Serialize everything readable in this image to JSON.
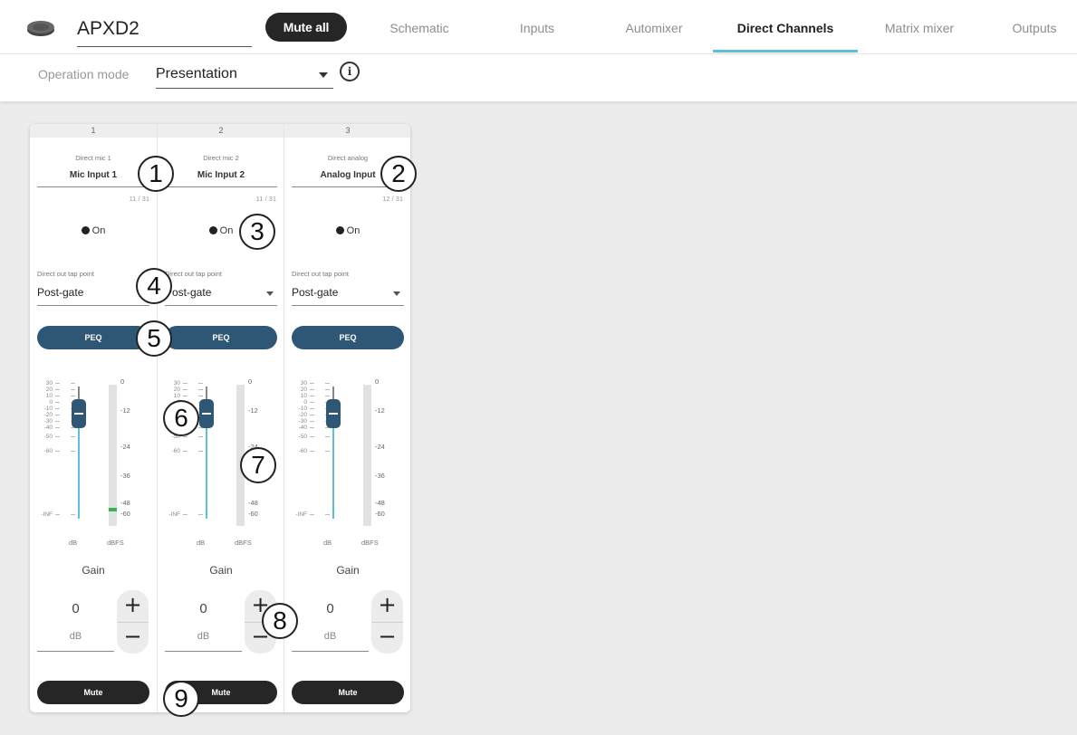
{
  "device": {
    "name": "APXD2",
    "mute_all": "Mute all"
  },
  "tabs": [
    {
      "label": "Schematic",
      "active": false
    },
    {
      "label": "Inputs",
      "active": false
    },
    {
      "label": "Automixer",
      "active": false
    },
    {
      "label": "Direct Channels",
      "active": true
    },
    {
      "label": "Matrix mixer",
      "active": false
    },
    {
      "label": "Outputs",
      "active": false
    }
  ],
  "operation_mode": {
    "label": "Operation mode",
    "value": "Presentation",
    "info_icon": "info-icon"
  },
  "accent_colors": {
    "peq": "#2e5776",
    "active_tab": "#5bc0de",
    "meter": "#3eb24a",
    "mute": "#262626"
  },
  "fader_scale": [
    "30",
    "20",
    "10",
    "0",
    "-10",
    "-20",
    "-30",
    "-40",
    "-50",
    "-60",
    "-INF"
  ],
  "meter_scale": [
    "0",
    "-12",
    "-24",
    "-36",
    "-48",
    "-60"
  ],
  "units": {
    "fader": "dB",
    "meter": "dBFS"
  },
  "channels": [
    {
      "number": "1",
      "type": "Direct mic 1",
      "name": "Mic Input 1",
      "count": "11 / 31",
      "state": "On",
      "tap_label": "Direct out tap point",
      "tap_value": "Post-gate",
      "peq": "PEQ",
      "gain_label": "Gain",
      "gain_value": "0",
      "gain_unit": "dB",
      "mute": "Mute",
      "meter_level": 0.1
    },
    {
      "number": "2",
      "type": "Direct mic 2",
      "name": "Mic Input 2",
      "count": "11 / 31",
      "state": "On",
      "tap_label": "Direct out tap point",
      "tap_value": "Post-gate",
      "peq": "PEQ",
      "gain_label": "Gain",
      "gain_value": "0",
      "gain_unit": "dB",
      "mute": "Mute",
      "meter_level": 0
    },
    {
      "number": "3",
      "type": "Direct analog",
      "name": "Analog Input",
      "count": "12 / 31",
      "state": "On",
      "tap_label": "Direct out tap point",
      "tap_value": "Post-gate",
      "peq": "PEQ",
      "gain_label": "Gain",
      "gain_value": "0",
      "gain_unit": "dB",
      "mute": "Mute",
      "meter_level": 0
    }
  ],
  "callouts": [
    "1",
    "2",
    "3",
    "4",
    "5",
    "6",
    "7",
    "8",
    "9"
  ]
}
